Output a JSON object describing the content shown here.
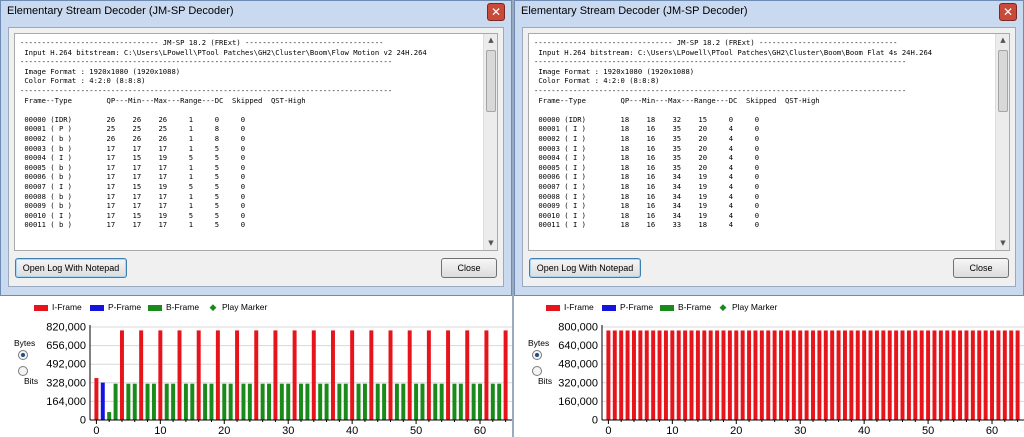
{
  "windows": [
    {
      "title": "Elementary Stream Decoder (JM-SP Decoder)",
      "log_lines": [
        "-------------------------------- JM-SP 18.2 (FRExt) --------------------------------",
        " Input H.264 bitstream: C:\\Users\\LPowell\\PTool Patches\\GH2\\Cluster\\Boom\\Flow Motion v2 24H.264",
        "--------------------------------------------------------------------------------------",
        " Image Format : 1920x1080 (1920x1088)",
        " Color Format : 4:2:0 (8:8:8)",
        "--------------------------------------------------------------------------------------",
        " Frame--Type        QP---Min---Max---Range---DC  Skipped  QST-High",
        "",
        " 00000 (IDR)        26    26    26     1     0     0",
        " 00001 ( P )        25    25    25     1     8     0",
        " 00002 ( b )        26    26    26     1     8     0",
        " 00003 ( b )        17    17    17     1     5     0",
        " 00004 ( I )        17    15    19     5     5     0",
        " 00005 ( b )        17    17    17     1     5     0",
        " 00006 ( b )        17    17    17     1     5     0",
        " 00007 ( I )        17    15    19     5     5     0",
        " 00008 ( b )        17    17    17     1     5     0",
        " 00009 ( b )        17    17    17     1     5     0",
        " 00010 ( I )        17    15    19     5     5     0",
        " 00011 ( b )        17    17    17     1     5     0"
      ],
      "open_label": "Open Log With Notepad",
      "close_label": "Close"
    },
    {
      "title": "Elementary Stream Decoder (JM-SP Decoder)",
      "log_lines": [
        "-------------------------------- JM-SP 18.2 (FRExt) --------------------------------",
        " Input H.264 bitstream: C:\\Users\\LPowell\\PTool Patches\\GH2\\Cluster\\Boom\\Boom Flat 4s 24H.264",
        "--------------------------------------------------------------------------------------",
        " Image Format : 1920x1080 (1920x1088)",
        " Color Format : 4:2:0 (8:8:8)",
        "--------------------------------------------------------------------------------------",
        " Frame--Type        QP---Min---Max---Range---DC  Skipped  QST-High",
        "",
        " 00000 (IDR)        18    18    32    15     0     0",
        " 00001 ( I )        18    16    35    20     4     0",
        " 00002 ( I )        18    16    35    20     4     0",
        " 00003 ( I )        18    16    35    20     4     0",
        " 00004 ( I )        18    16    35    20     4     0",
        " 00005 ( I )        18    16    35    20     4     0",
        " 00006 ( I )        18    16    34    19     4     0",
        " 00007 ( I )        18    16    34    19     4     0",
        " 00008 ( I )        18    16    34    19     4     0",
        " 00009 ( I )        18    16    34    19     4     0",
        " 00010 ( I )        18    16    34    19     4     0",
        " 00011 ( I )        18    16    33    18     4     0"
      ],
      "open_label": "Open Log With Notepad",
      "close_label": "Close"
    }
  ],
  "legend": {
    "i_frame": "I-Frame",
    "p_frame": "P-Frame",
    "b_frame": "B-Frame",
    "play_marker": "Play Marker"
  },
  "unit_options": {
    "bytes": "Bytes",
    "bits": "Bits",
    "selected": "Bytes"
  },
  "colors": {
    "i_frame": "#e8141c",
    "p_frame": "#1414e0",
    "b_frame": "#1a8a1a",
    "play_marker": "#1a8a1a"
  },
  "chart_data": [
    {
      "type": "bar",
      "yticks": [
        "820,000",
        "656,000",
        "492,000",
        "328,000",
        "164,000",
        "0"
      ],
      "ylim": [
        0,
        820000
      ],
      "xlim": [
        -1,
        65
      ],
      "xticks": [
        0,
        10,
        20,
        30,
        40,
        50,
        60
      ],
      "frames": [
        {
          "i": 0,
          "t": "I",
          "v": 370000
        },
        {
          "i": 1,
          "t": "P",
          "v": 330000
        },
        {
          "i": 2,
          "t": "B",
          "v": 70000
        },
        {
          "i": 3,
          "t": "B",
          "v": 320000
        },
        {
          "i": 4,
          "t": "I",
          "v": 790000
        },
        {
          "i": 5,
          "t": "B",
          "v": 320000
        },
        {
          "i": 6,
          "t": "B",
          "v": 320000
        },
        {
          "i": 7,
          "t": "I",
          "v": 790000
        },
        {
          "i": 8,
          "t": "B",
          "v": 320000
        },
        {
          "i": 9,
          "t": "B",
          "v": 320000
        },
        {
          "i": 10,
          "t": "I",
          "v": 790000
        },
        {
          "i": 11,
          "t": "B",
          "v": 320000
        },
        {
          "i": 12,
          "t": "B",
          "v": 320000
        },
        {
          "i": 13,
          "t": "I",
          "v": 790000
        },
        {
          "i": 14,
          "t": "B",
          "v": 320000
        },
        {
          "i": 15,
          "t": "B",
          "v": 320000
        },
        {
          "i": 16,
          "t": "I",
          "v": 790000
        },
        {
          "i": 17,
          "t": "B",
          "v": 320000
        },
        {
          "i": 18,
          "t": "B",
          "v": 320000
        },
        {
          "i": 19,
          "t": "I",
          "v": 790000
        },
        {
          "i": 20,
          "t": "B",
          "v": 320000
        },
        {
          "i": 21,
          "t": "B",
          "v": 320000
        },
        {
          "i": 22,
          "t": "I",
          "v": 790000
        },
        {
          "i": 23,
          "t": "B",
          "v": 320000
        },
        {
          "i": 24,
          "t": "B",
          "v": 320000
        },
        {
          "i": 25,
          "t": "I",
          "v": 790000
        },
        {
          "i": 26,
          "t": "B",
          "v": 320000
        },
        {
          "i": 27,
          "t": "B",
          "v": 320000
        },
        {
          "i": 28,
          "t": "I",
          "v": 790000
        },
        {
          "i": 29,
          "t": "B",
          "v": 320000
        },
        {
          "i": 30,
          "t": "B",
          "v": 320000
        },
        {
          "i": 31,
          "t": "I",
          "v": 790000
        },
        {
          "i": 32,
          "t": "B",
          "v": 320000
        },
        {
          "i": 33,
          "t": "B",
          "v": 320000
        },
        {
          "i": 34,
          "t": "I",
          "v": 790000
        },
        {
          "i": 35,
          "t": "B",
          "v": 320000
        },
        {
          "i": 36,
          "t": "B",
          "v": 320000
        },
        {
          "i": 37,
          "t": "I",
          "v": 790000
        },
        {
          "i": 38,
          "t": "B",
          "v": 320000
        },
        {
          "i": 39,
          "t": "B",
          "v": 320000
        },
        {
          "i": 40,
          "t": "I",
          "v": 790000
        },
        {
          "i": 41,
          "t": "B",
          "v": 320000
        },
        {
          "i": 42,
          "t": "B",
          "v": 320000
        },
        {
          "i": 43,
          "t": "I",
          "v": 790000
        },
        {
          "i": 44,
          "t": "B",
          "v": 320000
        },
        {
          "i": 45,
          "t": "B",
          "v": 320000
        },
        {
          "i": 46,
          "t": "I",
          "v": 790000
        },
        {
          "i": 47,
          "t": "B",
          "v": 320000
        },
        {
          "i": 48,
          "t": "B",
          "v": 320000
        },
        {
          "i": 49,
          "t": "I",
          "v": 790000
        },
        {
          "i": 50,
          "t": "B",
          "v": 320000
        },
        {
          "i": 51,
          "t": "B",
          "v": 320000
        },
        {
          "i": 52,
          "t": "I",
          "v": 790000
        },
        {
          "i": 53,
          "t": "B",
          "v": 320000
        },
        {
          "i": 54,
          "t": "B",
          "v": 320000
        },
        {
          "i": 55,
          "t": "I",
          "v": 790000
        },
        {
          "i": 56,
          "t": "B",
          "v": 320000
        },
        {
          "i": 57,
          "t": "B",
          "v": 320000
        },
        {
          "i": 58,
          "t": "I",
          "v": 790000
        },
        {
          "i": 59,
          "t": "B",
          "v": 320000
        },
        {
          "i": 60,
          "t": "B",
          "v": 320000
        },
        {
          "i": 61,
          "t": "I",
          "v": 790000
        },
        {
          "i": 62,
          "t": "B",
          "v": 320000
        },
        {
          "i": 63,
          "t": "B",
          "v": 320000
        },
        {
          "i": 64,
          "t": "I",
          "v": 790000
        }
      ]
    },
    {
      "type": "bar",
      "yticks": [
        "800,000",
        "640,000",
        "480,000",
        "320,000",
        "160,000",
        "0"
      ],
      "ylim": [
        0,
        800000
      ],
      "xlim": [
        -1,
        65
      ],
      "xticks": [
        0,
        10,
        20,
        30,
        40,
        50,
        60
      ],
      "frame_type": "I",
      "frame_count": 65,
      "value": 770000
    }
  ]
}
